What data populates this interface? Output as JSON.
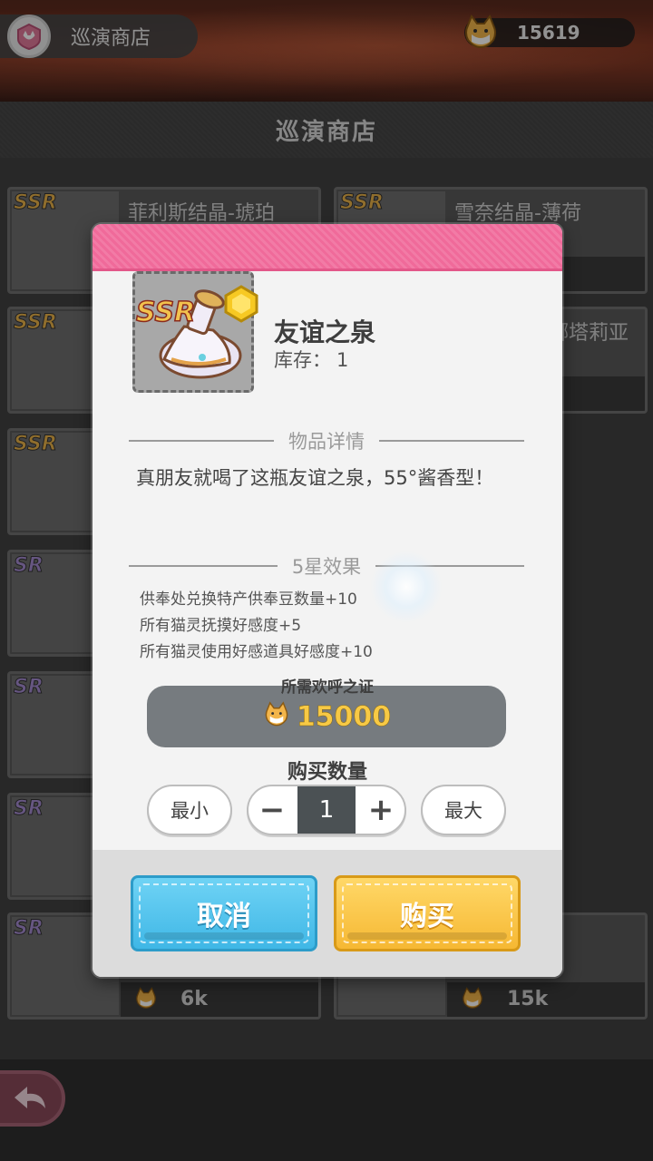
{
  "header": {
    "shop_tag_label": "巡演商店",
    "currency_amount": "15619",
    "page_title": "巡演商店"
  },
  "background_cards": [
    {
      "rarity": "SSR",
      "name": "菲利斯结晶-琥珀",
      "price": ""
    },
    {
      "rarity": "SSR",
      "name": "雪奈结晶-薄荷",
      "price": ""
    },
    {
      "rarity": "SSR",
      "name": "",
      "price": ""
    },
    {
      "rarity": "",
      "name": "娜塔莉亚",
      "price": ""
    },
    {
      "rarity": "SSR",
      "name": "",
      "price": ""
    },
    {
      "rarity": "SR",
      "name": "",
      "price": ""
    },
    {
      "rarity": "SR",
      "name": "",
      "price": ""
    },
    {
      "rarity": "SR",
      "name": "",
      "price": ""
    },
    {
      "rarity": "SR",
      "name": "",
      "price": "6k"
    },
    {
      "rarity": "",
      "name": "",
      "price": "15k"
    }
  ],
  "modal": {
    "item": {
      "rarity": "SSR",
      "name": "友谊之泉",
      "stock_label": "库存：",
      "stock_value": "1"
    },
    "details_heading": "物品详情",
    "description": "真朋友就喝了这瓶友谊之泉，55°酱香型！",
    "effects_heading": "5星效果",
    "effects": [
      "供奉处兑换特产供奉豆数量+10",
      "所有猫灵抚摸好感度+5",
      "所有猫灵使用好感道具好感度+10"
    ],
    "price_label": "所需欢呼之证",
    "price_amount": "15000",
    "quantity_label": "购买数量",
    "min_label": "最小",
    "max_label": "最大",
    "quantity_value": "1",
    "cancel_label": "取消",
    "buy_label": "购买"
  },
  "colors": {
    "modal_header_pink": "#f06a9a",
    "cancel_blue": "#3fb7e6",
    "buy_orange": "#f6b833",
    "price_gold": "#f7c945"
  }
}
